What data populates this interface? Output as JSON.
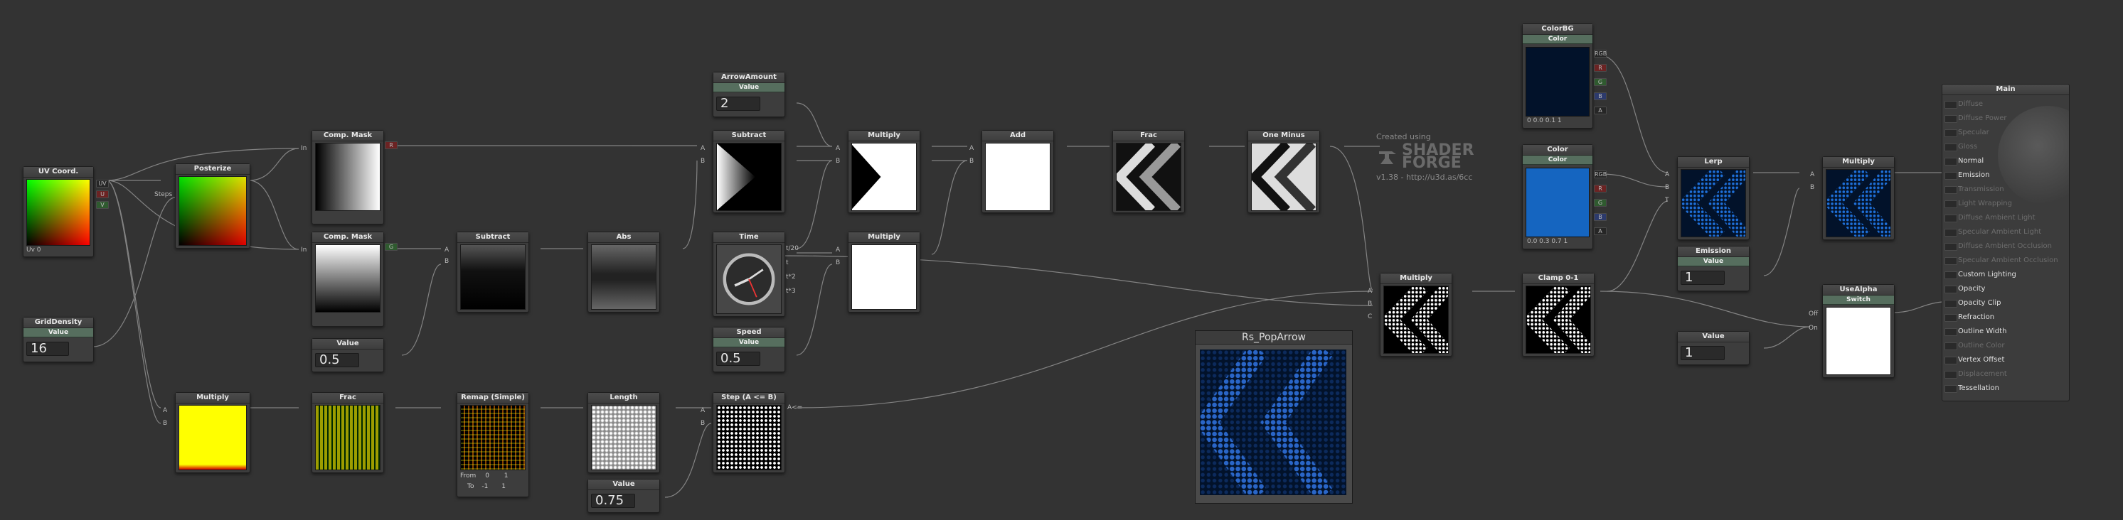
{
  "logo": {
    "created_using": "Created using",
    "brand_top": "SHADER",
    "brand_bottom": "FORGE",
    "version": "v1.38 - http://u3d.as/6cc"
  },
  "preview_window": {
    "title": "Rs_PopArrow"
  },
  "nodes": {
    "uv": {
      "title": "UV Coord.",
      "ports": [
        "UV",
        "U",
        "V"
      ],
      "footer": "Uv 0"
    },
    "grid_density": {
      "title": "GridDensity",
      "sub": "Value",
      "value": "16"
    },
    "posterize": {
      "title": "Posterize",
      "port_in": "Steps"
    },
    "comp_mask_r": {
      "title": "Comp. Mask",
      "port_in": "In",
      "out": "R"
    },
    "comp_mask_g": {
      "title": "Comp. Mask",
      "port_in": "In",
      "out": "G"
    },
    "value_half": {
      "title": "Value",
      "value": "0.5"
    },
    "subtract_1": {
      "title": "Subtract",
      "a": "A",
      "b": "B"
    },
    "abs": {
      "title": "Abs"
    },
    "arrow_amount": {
      "title": "ArrowAmount",
      "sub": "Value",
      "value": "2"
    },
    "subtract_2": {
      "title": "Subtract",
      "a": "A",
      "b": "B"
    },
    "time": {
      "title": "Time",
      "outs": [
        "t/20",
        "t",
        "t*2",
        "t*3"
      ]
    },
    "speed": {
      "title": "Speed",
      "sub": "Value",
      "value": "0.5"
    },
    "multiply_top": {
      "title": "Multiply",
      "a": "A",
      "b": "B"
    },
    "multiply_mid": {
      "title": "Multiply",
      "a": "A",
      "b": "B"
    },
    "add": {
      "title": "Add",
      "a": "A",
      "b": "B"
    },
    "frac_top": {
      "title": "Frac"
    },
    "one_minus": {
      "title": "One Minus"
    },
    "multiply_grid": {
      "title": "Multiply",
      "a": "A",
      "b": "B"
    },
    "frac_bottom": {
      "title": "Frac"
    },
    "remap": {
      "title": "Remap (Simple)",
      "from_label": "From",
      "from_a": "0",
      "from_b": "1",
      "to_label": "To",
      "to_a": "-1",
      "to_b": "1"
    },
    "length": {
      "title": "Length"
    },
    "value_075": {
      "title": "Value",
      "value": "0.75"
    },
    "step": {
      "title": "Step (A <= B)",
      "a": "A",
      "b": "B",
      "out": "A<="
    },
    "multiply_combine": {
      "title": "Multiply",
      "a": "A",
      "b": "B",
      "c": "C"
    },
    "clamp": {
      "title": "Clamp 0-1"
    },
    "colorbg": {
      "title": "ColorBG",
      "sub": "Color",
      "values": "0   0.0  0.1  1",
      "ports": [
        "RGB",
        "R",
        "G",
        "B",
        "A"
      ]
    },
    "color": {
      "title": "Color",
      "sub": "Color",
      "values": "0.0  0.3  0.7  1",
      "ports": [
        "RGB",
        "R",
        "G",
        "B",
        "A"
      ]
    },
    "lerp": {
      "title": "Lerp",
      "a": "A",
      "b": "B",
      "t": "T"
    },
    "multiply_final": {
      "title": "Multiply",
      "a": "A",
      "b": "B"
    },
    "emission": {
      "title": "Emission",
      "sub": "Value",
      "value": "1"
    },
    "value_one": {
      "title": "Value",
      "value": "1"
    },
    "use_alpha": {
      "title": "UseAlpha",
      "sub": "Switch",
      "off": "Off",
      "on": "On"
    }
  },
  "main": {
    "title": "Main",
    "rows": [
      {
        "label": "Diffuse",
        "active": false
      },
      {
        "label": "Diffuse Power",
        "active": false
      },
      {
        "label": "Specular",
        "active": false
      },
      {
        "label": "Gloss",
        "active": false
      },
      {
        "label": "Normal",
        "active": true
      },
      {
        "label": "Emission",
        "active": true
      },
      {
        "label": "Transmission",
        "active": false
      },
      {
        "label": "Light Wrapping",
        "active": false
      },
      {
        "label": "Diffuse Ambient Light",
        "active": false
      },
      {
        "label": "Specular Ambient Light",
        "active": false
      },
      {
        "label": "Diffuse Ambient Occlusion",
        "active": false
      },
      {
        "label": "Specular Ambient Occlusion",
        "active": false
      },
      {
        "label": "Custom Lighting",
        "active": true
      },
      {
        "label": "Opacity",
        "active": true
      },
      {
        "label": "Opacity Clip",
        "active": true
      },
      {
        "label": "Refraction",
        "active": true
      },
      {
        "label": "Outline Width",
        "active": true
      },
      {
        "label": "Outline Color",
        "active": false
      },
      {
        "label": "Vertex Offset",
        "active": true
      },
      {
        "label": "Displacement",
        "active": false
      },
      {
        "label": "Tessellation",
        "active": true
      }
    ]
  },
  "colors": {
    "background": "#333333",
    "node": "#3d3d3d",
    "header": "#566e5e",
    "accent_blue": "#1565c0",
    "dark_navy": "#02122a",
    "wire": "#8c8c8c"
  }
}
